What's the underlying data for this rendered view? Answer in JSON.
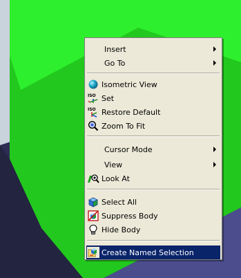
{
  "menu": {
    "items": [
      {
        "label": "Insert",
        "icon": null,
        "submenu": true
      },
      {
        "label": "Go To",
        "icon": null,
        "submenu": true
      },
      {
        "label": "Isometric View",
        "icon": "isometric-sphere-icon",
        "submenu": false
      },
      {
        "label": "Set",
        "icon": "iso-set-icon",
        "submenu": false
      },
      {
        "label": "Restore Default",
        "icon": "iso-restore-icon",
        "submenu": false
      },
      {
        "label": "Zoom To Fit",
        "icon": "zoom-to-fit-icon",
        "submenu": false
      },
      {
        "label": "Cursor Mode",
        "icon": null,
        "submenu": true
      },
      {
        "label": "View",
        "icon": null,
        "submenu": true
      },
      {
        "label": "Look At",
        "icon": "look-at-icon",
        "submenu": false
      },
      {
        "label": "Select All",
        "icon": "select-all-icon",
        "submenu": false
      },
      {
        "label": "Suppress Body",
        "icon": "suppress-body-icon",
        "submenu": false
      },
      {
        "label": "Hide Body",
        "icon": "hide-body-icon",
        "submenu": false
      },
      {
        "label": "Create Named Selection",
        "icon": "named-selection-icon",
        "submenu": false,
        "selected": true
      }
    ],
    "iso_text": "ISO"
  },
  "colors": {
    "model_green_dark": "#22c81e",
    "model_green_light": "#33ff33",
    "background_navy": "#2b2d52",
    "background_blue": "#4b4d8d",
    "menu_bg": "#ece9d8",
    "highlight": "#0a246a"
  }
}
